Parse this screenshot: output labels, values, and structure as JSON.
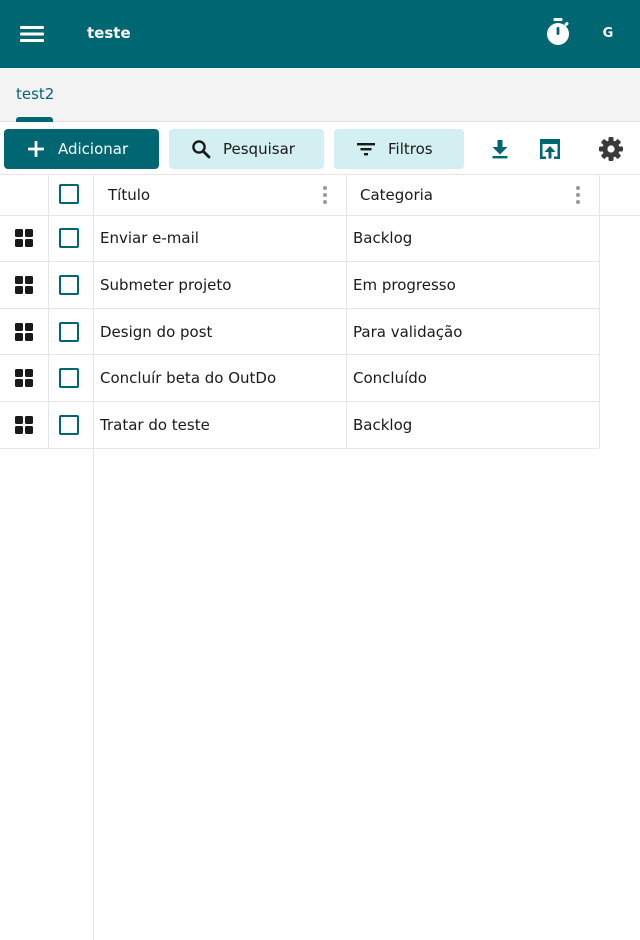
{
  "appbar": {
    "menu_icon": "hamburger-menu-icon",
    "title": "teste",
    "timer_icon": "stopwatch-icon",
    "avatar_initial": "G",
    "color": "#006672"
  },
  "tabs": [
    {
      "label": "test2",
      "active": true
    }
  ],
  "toolbar": {
    "add_label": "Adicionar",
    "search_label": "Pesquisar",
    "filter_label": "Filtros",
    "download_icon": "download-icon",
    "open_icon": "open-in-browser-icon",
    "settings_icon": "gear-icon"
  },
  "table": {
    "columns": [
      {
        "label": "Título"
      },
      {
        "label": "Categoria"
      }
    ],
    "rows": [
      {
        "titulo": "Enviar e-mail",
        "categoria": "Backlog"
      },
      {
        "titulo": "Submeter projeto",
        "categoria": "Em progresso"
      },
      {
        "titulo": "Design do post",
        "categoria": "Para validação"
      },
      {
        "titulo": "Concluír beta do OutDo",
        "categoria": "Concluído"
      },
      {
        "titulo": "Tratar do teste",
        "categoria": "Backlog"
      }
    ]
  },
  "colors": {
    "primary": "#006672",
    "secondary_button": "#d3eff2",
    "tab_bar": "#f3f3f3"
  }
}
